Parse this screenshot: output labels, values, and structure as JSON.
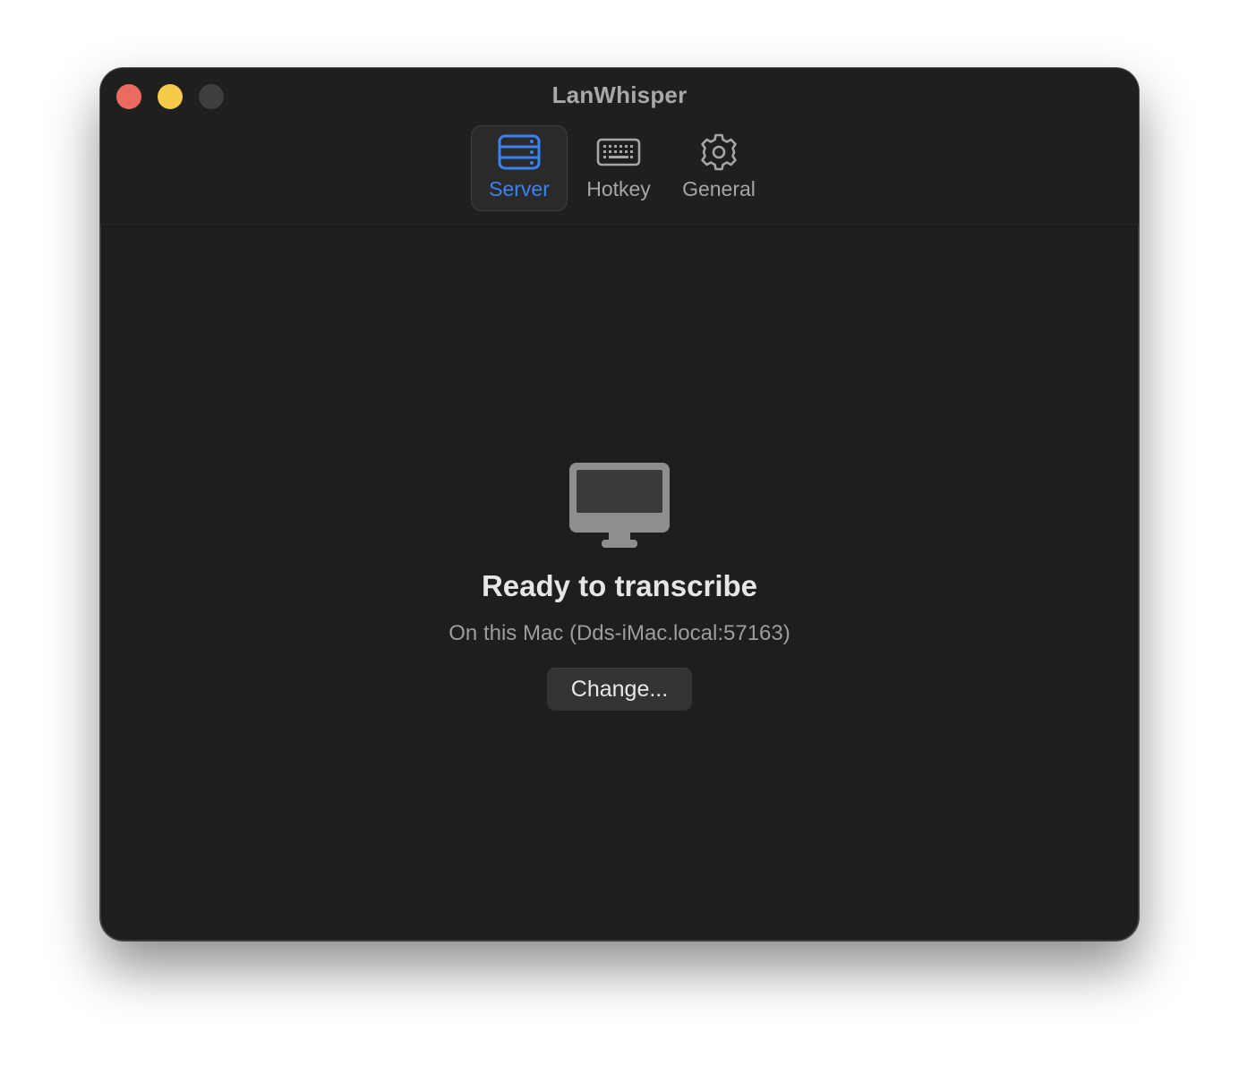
{
  "window": {
    "title": "LanWhisper"
  },
  "traffic_lights": {
    "close_color": "#ed6a5e",
    "minimize_color": "#f5c94a",
    "zoom_color": "#3e3e3e"
  },
  "toolbar": {
    "tabs": [
      {
        "label": "Server",
        "icon": "server-icon",
        "selected": true
      },
      {
        "label": "Hotkey",
        "icon": "keyboard-icon",
        "selected": false
      },
      {
        "label": "General",
        "icon": "gear-icon",
        "selected": false
      }
    ],
    "accent_color": "#3b82f0"
  },
  "status": {
    "icon": "desktop-computer-icon",
    "title": "Ready to transcribe",
    "subtitle": "On this Mac (Dds-iMac.local:57163)",
    "change_button_label": "Change..."
  }
}
